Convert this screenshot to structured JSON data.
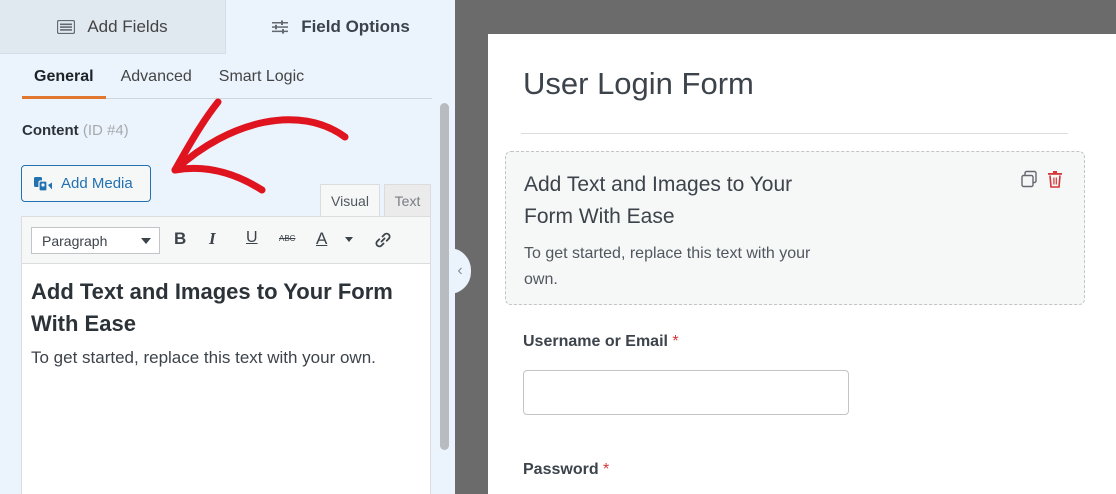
{
  "left_panel": {
    "top_tabs": {
      "add_fields": "Add Fields",
      "field_options": "Field Options"
    },
    "sub_tabs": {
      "general": "General",
      "advanced": "Advanced",
      "smart_logic": "Smart Logic"
    },
    "content_label": "Content",
    "content_id": "(ID #4)",
    "add_media": "Add Media",
    "editor_tabs": {
      "visual": "Visual",
      "text": "Text"
    },
    "format_select": "Paragraph",
    "toolbar": {
      "bold": "B",
      "italic": "I",
      "underline": "U",
      "strike": "ABC",
      "text_color": "A"
    },
    "editor_heading": "Add Text and Images to Your Form With Ease",
    "editor_paragraph": "To get started, replace this text with your own."
  },
  "form": {
    "title": "User Login Form",
    "content_heading": "Add Text and Images to Your Form With Ease",
    "content_text": "To get started, replace this text with your own.",
    "username_label": "Username or Email",
    "password_label": "Password",
    "required_mark": "*"
  },
  "colors": {
    "accent_orange": "#e27730",
    "link_blue": "#2271b1",
    "annotation_red": "#e0141e",
    "required_red": "#d63638"
  }
}
